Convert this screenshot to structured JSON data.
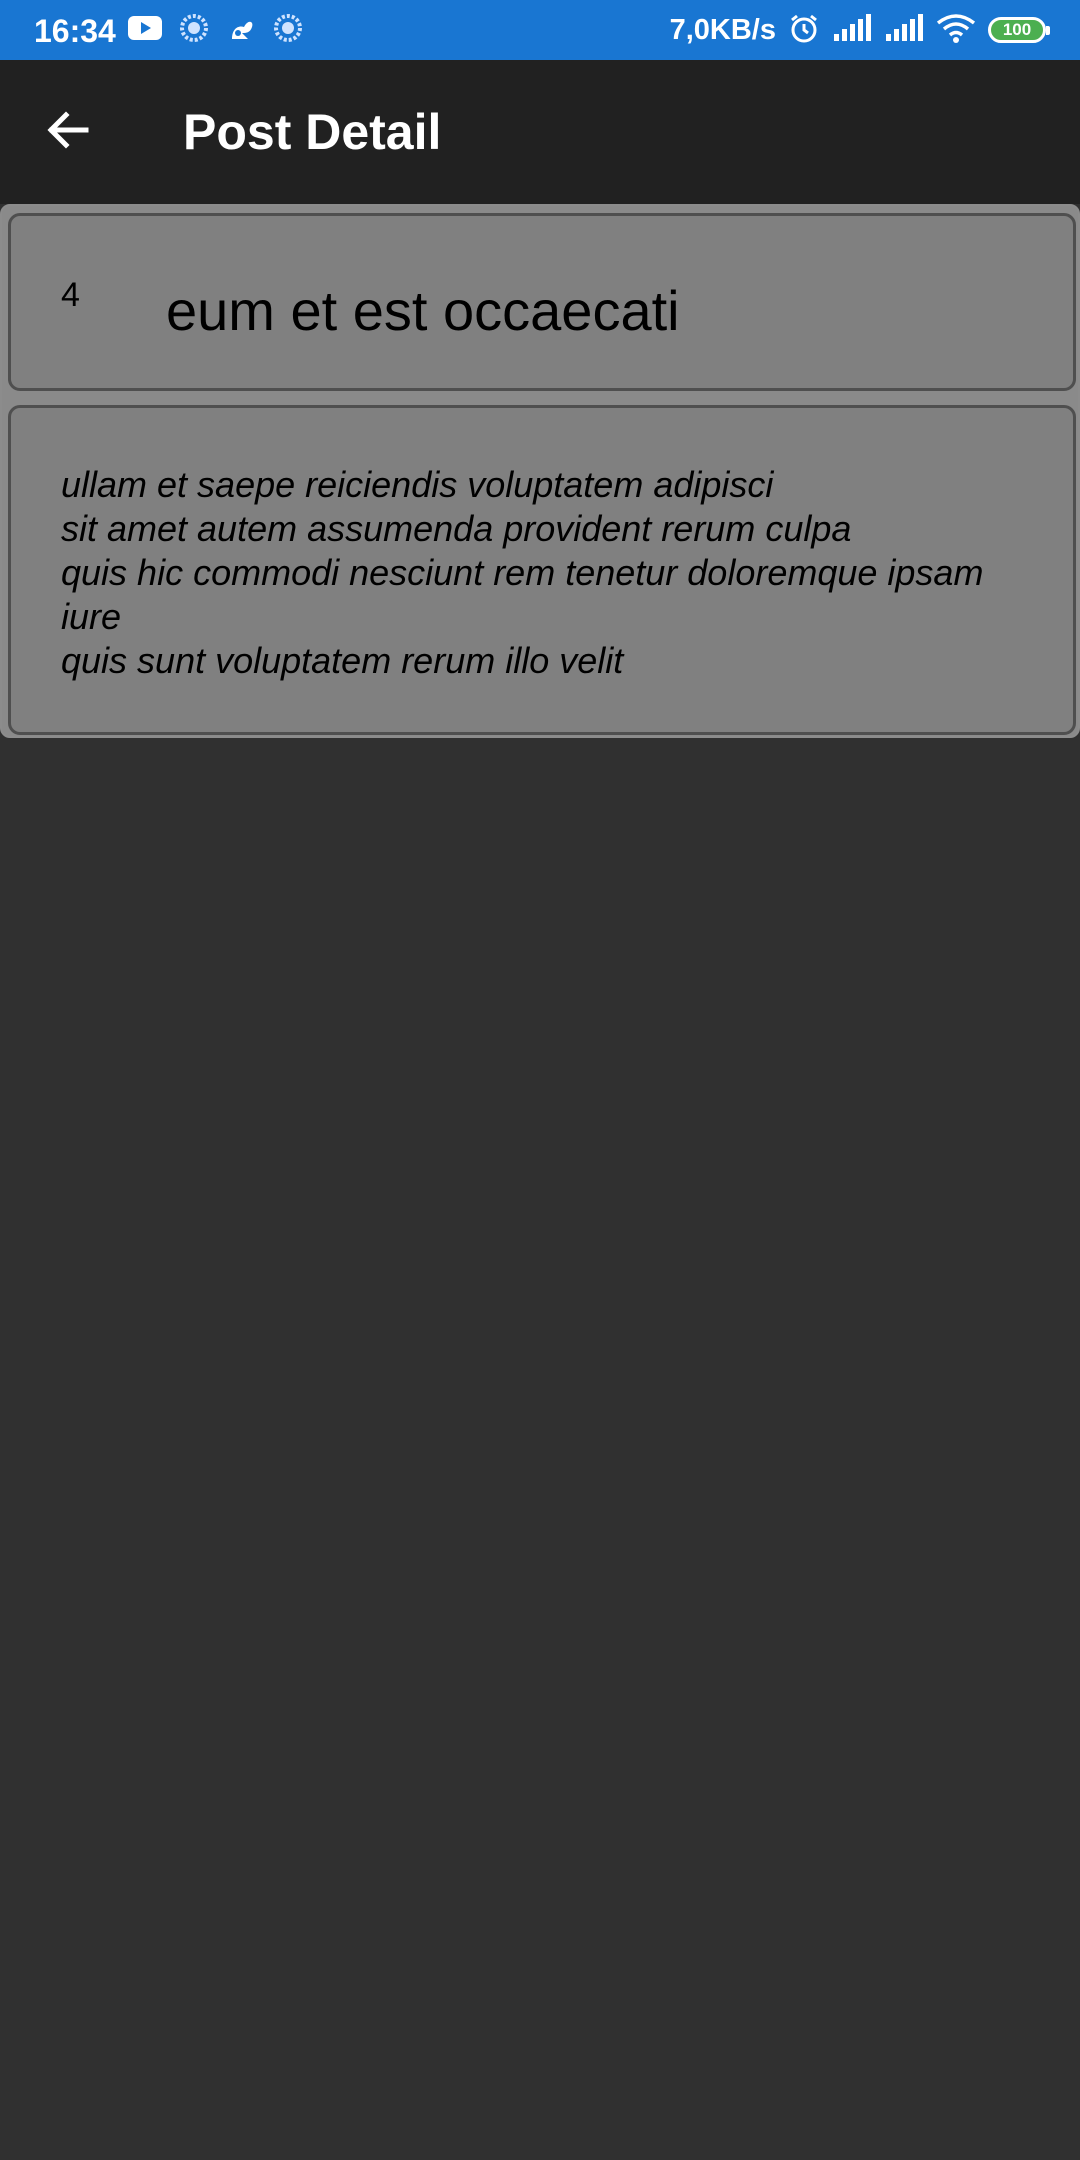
{
  "status_bar": {
    "time": "16:34",
    "net_speed": "7,0KB/s",
    "battery": "100",
    "icons_left": [
      "youtube-icon",
      "loading-icon",
      "squirrel-icon",
      "loading-icon"
    ],
    "icons_right": [
      "alarm-icon",
      "signal-icon",
      "signal-icon",
      "wifi-icon",
      "battery-icon"
    ],
    "bg_color": "#1976d2"
  },
  "app_bar": {
    "title": "Post Detail",
    "back_icon": "arrow-back-icon",
    "bg_color": "#212121"
  },
  "post": {
    "id": "4",
    "title": "eum et est occaecati",
    "body": "ullam et saepe reiciendis voluptatem adipisci\nsit amet autem assumenda provident rerum culpa\nquis hic commodi nesciunt rem tenetur doloremque ipsam iure\nquis sunt voluptatem rerum illo velit"
  },
  "colors": {
    "background": "#303030",
    "card": "#808080",
    "card_border": "#4f4f4f"
  }
}
